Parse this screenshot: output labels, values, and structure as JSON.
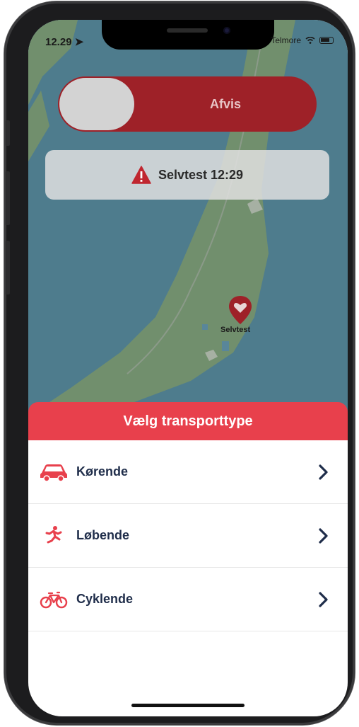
{
  "status_bar": {
    "time": "12.29",
    "carrier": "Telmore"
  },
  "colors": {
    "brand_red": "#e8404c",
    "slider_red": "#9e2128",
    "label_navy": "#1f2d4a"
  },
  "alarm": {
    "dismiss_label": "Afvis",
    "alert_text": "Selvtest 12:29",
    "alert_icon": "warning-triangle-icon"
  },
  "map": {
    "pin_label": "Selvtest",
    "pin_icon": "heart-pin-icon"
  },
  "transport_sheet": {
    "title": "Vælg transporttype",
    "options": [
      {
        "label": "Kørende",
        "icon": "car-icon"
      },
      {
        "label": "Løbende",
        "icon": "runner-icon"
      },
      {
        "label": "Cyklende",
        "icon": "bicycle-icon"
      }
    ]
  }
}
